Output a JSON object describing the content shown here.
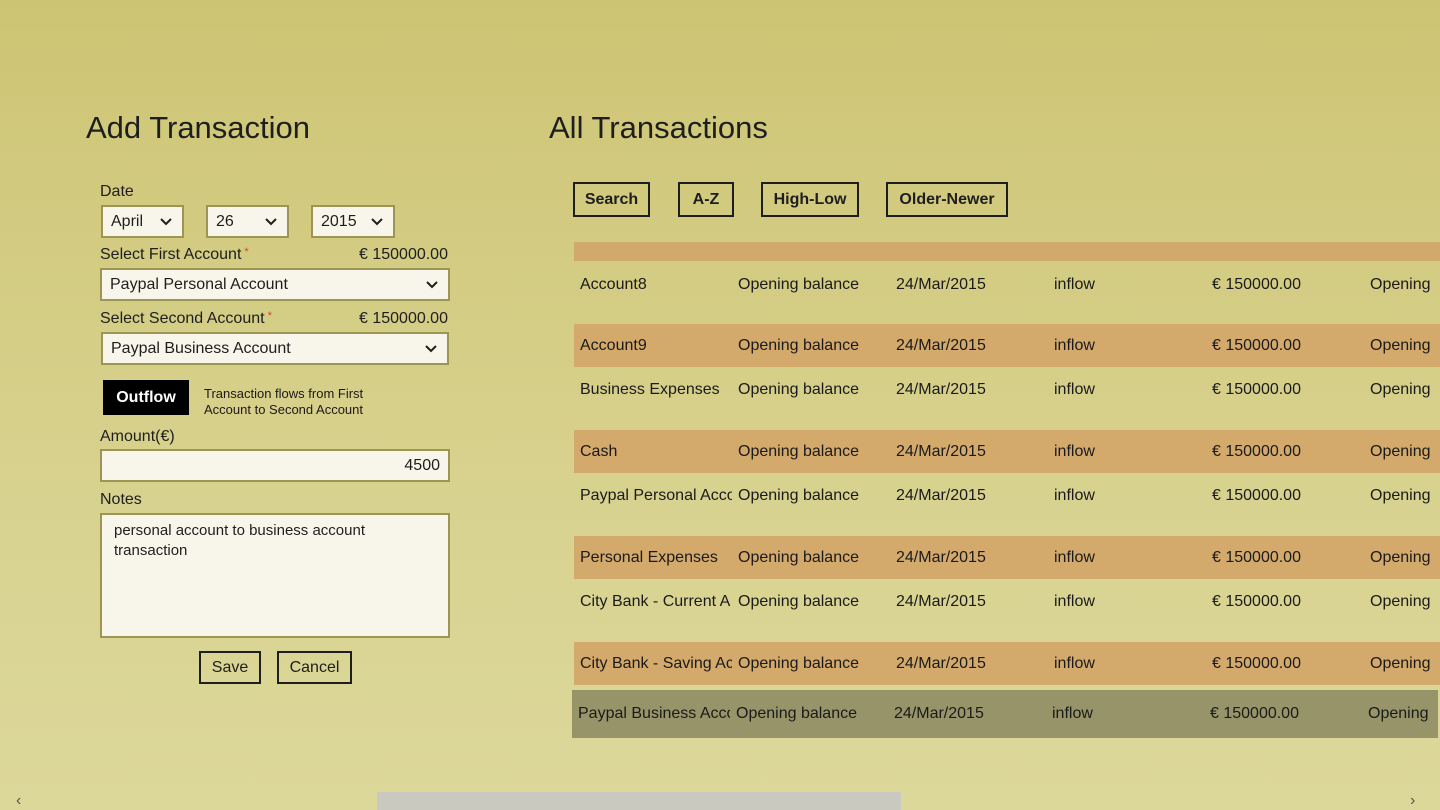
{
  "left": {
    "title": "Add Transaction",
    "date_label": "Date",
    "month": "April",
    "day": "26",
    "year": "2015",
    "first_account_label": "Select First Account",
    "first_account_balance": "€ 150000.00",
    "first_account": "Paypal Personal Account",
    "second_account_label": "Select Second Account",
    "second_account_balance": "€ 150000.00",
    "second_account": "Paypal Business Account",
    "required_mark": "*",
    "flow_toggle": "Outflow",
    "flow_hint": "Transaction flows from First Account to Second Account",
    "amount_label": "Amount(€)",
    "amount": "4500",
    "notes_label": "Notes",
    "notes": "personal account to business account transaction",
    "save": "Save",
    "cancel": "Cancel"
  },
  "right": {
    "title": "All Transactions",
    "buttons": [
      "Search",
      "A-Z",
      "High-Low",
      "Older-Newer"
    ],
    "rows": [
      [
        "Account8",
        "Opening balance",
        "24/Mar/2015",
        "inflow",
        "€ 150000.00",
        "Opening"
      ],
      [
        "Account9",
        "Opening balance",
        "24/Mar/2015",
        "inflow",
        "€ 150000.00",
        "Opening"
      ],
      [
        "Business Expenses",
        "Opening balance",
        "24/Mar/2015",
        "inflow",
        "€ 150000.00",
        "Opening"
      ],
      [
        "Cash",
        "Opening balance",
        "24/Mar/2015",
        "inflow",
        "€ 150000.00",
        "Opening"
      ],
      [
        "Paypal Personal Acco",
        "Opening balance",
        "24/Mar/2015",
        "inflow",
        "€ 150000.00",
        "Opening"
      ],
      [
        "Personal Expenses",
        "Opening balance",
        "24/Mar/2015",
        "inflow",
        "€ 150000.00",
        "Opening"
      ],
      [
        "City Bank - Current A",
        "Opening balance",
        "24/Mar/2015",
        "inflow",
        "€ 150000.00",
        "Opening"
      ],
      [
        "City Bank - Saving Ac",
        "Opening balance",
        "24/Mar/2015",
        "inflow",
        "€ 150000.00",
        "Opening"
      ],
      [
        "Paypal Business Acco",
        "Opening balance",
        "24/Mar/2015",
        "inflow",
        "€ 150000.00",
        "Opening"
      ]
    ]
  },
  "colors": {
    "row_alt": "#d4a96c",
    "row_selected": "#979469",
    "background": "#d8d28f"
  }
}
